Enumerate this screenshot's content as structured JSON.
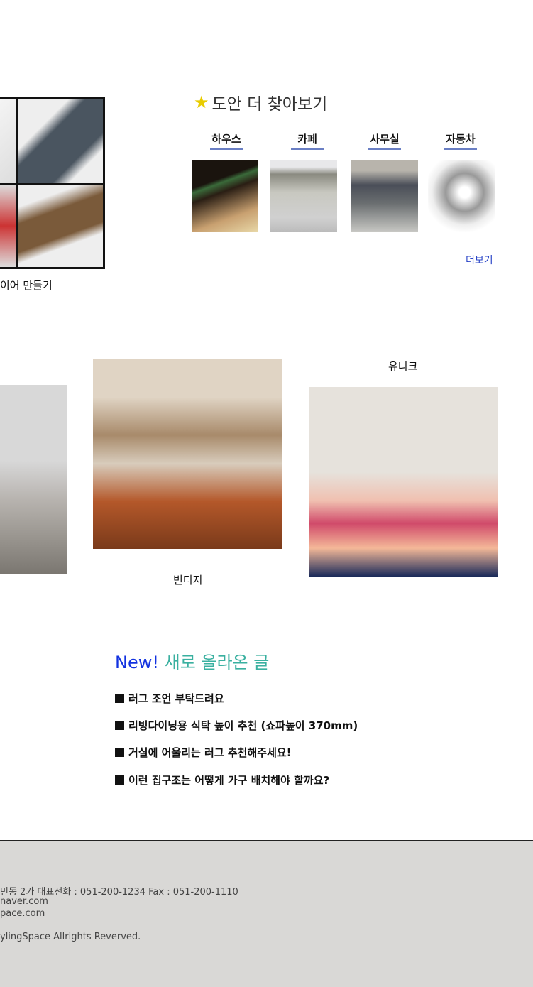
{
  "plans": {
    "caption": "이어 만들기"
  },
  "more_designs": {
    "title": "도안 더 찾아보기",
    "categories": [
      {
        "label": "하우스"
      },
      {
        "label": "카페"
      },
      {
        "label": "사무실"
      },
      {
        "label": "자동차"
      }
    ],
    "more_link": "더보기"
  },
  "styles": {
    "vintage": "빈티지",
    "unique": "유니크"
  },
  "new_posts": {
    "new_label": "New!",
    "title": "새로 올라온 글",
    "items": [
      "러그 조언 부탁드려요",
      "리빙다이닝용 식탁 높이 추천 (쇼파높이 370mm)",
      "거실에 어울리는 러그 추천해주세요!",
      "이런 집구조는 어떻게 가구 배치해야 할까요?"
    ]
  },
  "footer": {
    "address_line": "민동 2가  대표전화 : 051-200-1234 Fax : 051-200-1110",
    "email_line": "naver.com",
    "site_line": "pace.com",
    "copyright": "ylingSpace Allrights Reverved."
  }
}
